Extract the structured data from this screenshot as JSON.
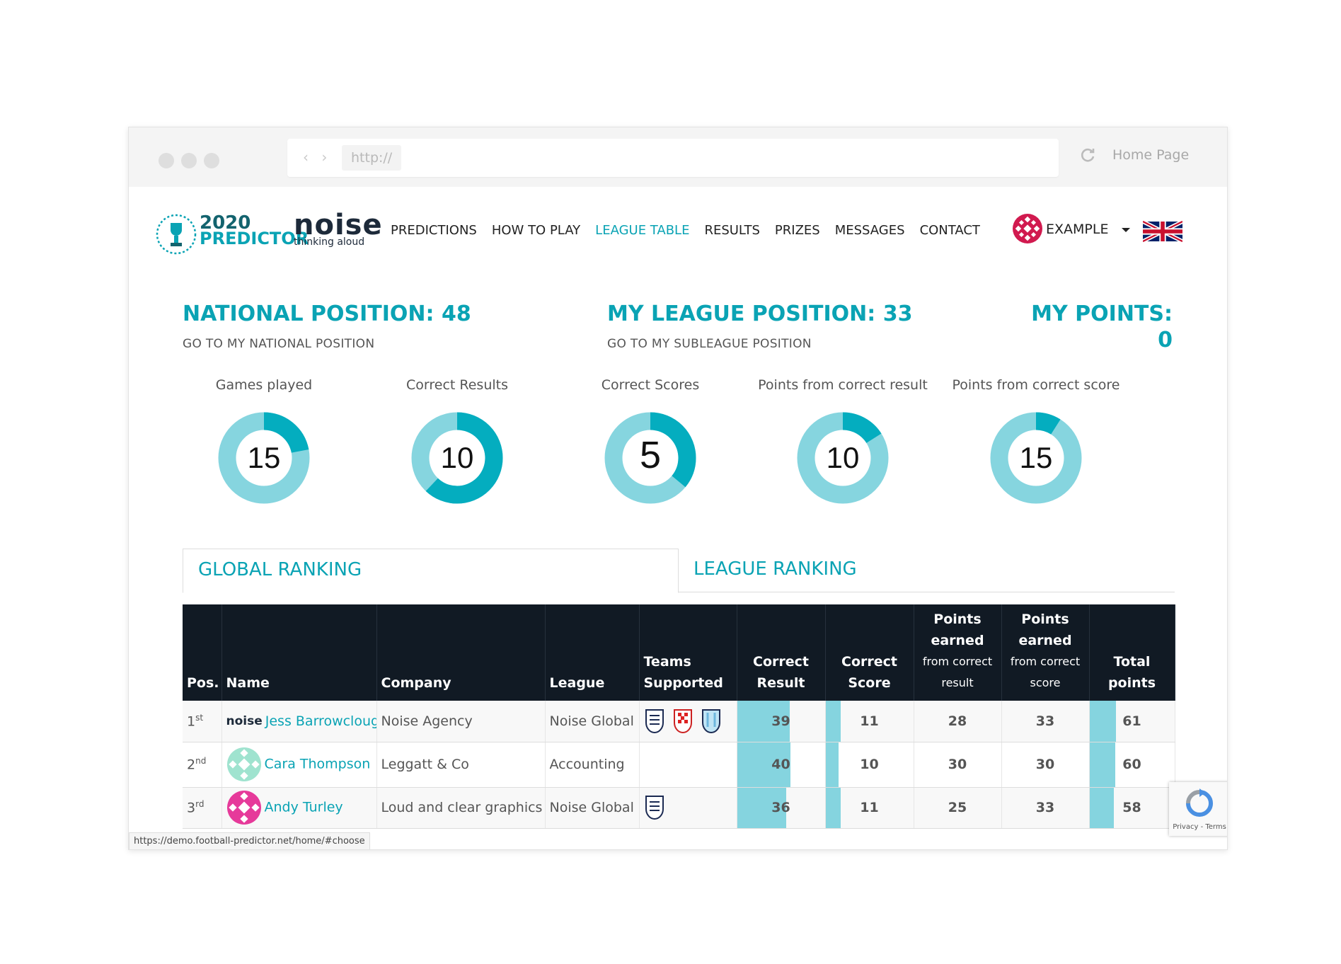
{
  "browser": {
    "url": "http://",
    "home_link": "Home Page"
  },
  "header": {
    "logo_year": "2020",
    "logo_word": "PREDICTOR",
    "brand_name": "noise",
    "brand_tagline": "thinking aloud",
    "nav": [
      {
        "label": "PREDICTIONS",
        "active": false
      },
      {
        "label": "HOW TO PLAY",
        "active": false
      },
      {
        "label": "LEAGUE TABLE",
        "active": true
      },
      {
        "label": "RESULTS",
        "active": false
      },
      {
        "label": "PRIZES",
        "active": false
      },
      {
        "label": "MESSAGES",
        "active": false
      },
      {
        "label": "CONTACT",
        "active": false
      }
    ],
    "user": "EXAMPLE"
  },
  "positions": {
    "national_title": "NATIONAL POSITION: 48",
    "national_link": "GO TO MY NATIONAL POSITION",
    "league_title": "MY LEAGUE POSITION: 33",
    "league_link": "GO TO MY SUBLEAGUE POSITION",
    "points_title": "MY POINTS:",
    "points_value": "0"
  },
  "stats": [
    {
      "label": "Games played",
      "value": "15",
      "fraction": 0.22
    },
    {
      "label": "Correct Results",
      "value": "10",
      "fraction": 0.62
    },
    {
      "label": "Correct Scores",
      "value": "5",
      "fraction": 0.36
    },
    {
      "label": "Points from correct result",
      "value": "10",
      "fraction": 0.16
    },
    {
      "label": "Points from correct score",
      "value": "15",
      "fraction": 0.09
    }
  ],
  "tabs": {
    "global": "GLOBAL RANKING",
    "league": "LEAGUE RANKING"
  },
  "table": {
    "headers": {
      "pos": "Pos.",
      "name": "Name",
      "company": "Company",
      "league": "League",
      "teams_1": "Teams",
      "teams_2": "Supported",
      "cr_1": "Correct",
      "cr_2": "Result",
      "cs_1": "Correct",
      "cs_2": "Score",
      "per_1": "Points",
      "per_2": "earned",
      "per_3": "from correct",
      "per_4": "result",
      "pes_1": "Points",
      "pes_2": "earned",
      "pes_3": "from correct",
      "pes_4": "score",
      "tp_1": "Total",
      "tp_2": "points"
    },
    "rows": [
      {
        "pos": "1",
        "suffix": "st",
        "avatar": "noise-logo",
        "avatar_text": "noise",
        "name": "Jess Barrowclough",
        "company": "Noise Agency",
        "league": "Noise Global",
        "teams": [
          "england-badge",
          "croatia-badge",
          "argentina-badge"
        ],
        "correct_result": "39",
        "correct_result_frac": 0.6,
        "correct_score": "11",
        "correct_score_frac": 0.17,
        "pts_result": "28",
        "pts_score": "33",
        "total": "61",
        "total_frac": 0.31
      },
      {
        "pos": "2",
        "suffix": "nd",
        "avatar": "teal-pattern-avatar",
        "name": "Cara Thompson",
        "company": "Leggatt & Co",
        "league": "Accounting",
        "teams": [],
        "correct_result": "40",
        "correct_result_frac": 0.61,
        "correct_score": "10",
        "correct_score_frac": 0.15,
        "pts_result": "30",
        "pts_score": "30",
        "total": "60",
        "total_frac": 0.3
      },
      {
        "pos": "3",
        "suffix": "rd",
        "avatar": "pink-pattern-avatar",
        "name": "Andy Turley",
        "company": "Loud and clear graphics",
        "league": "Noise Global",
        "teams": [
          "england-badge"
        ],
        "correct_result": "36",
        "correct_result_frac": 0.56,
        "correct_score": "11",
        "correct_score_frac": 0.17,
        "pts_result": "25",
        "pts_score": "33",
        "total": "58",
        "total_frac": 0.29
      }
    ]
  },
  "status_bar": "https://demo.football-predictor.net/home/#choose",
  "recaptcha": "Privacy - Terms",
  "colors": {
    "accent": "#0aa3b4",
    "donut_light": "#86d5df",
    "donut_dark": "#04adbf",
    "table_header": "#111a24",
    "bar_fill": "#85d4df"
  }
}
